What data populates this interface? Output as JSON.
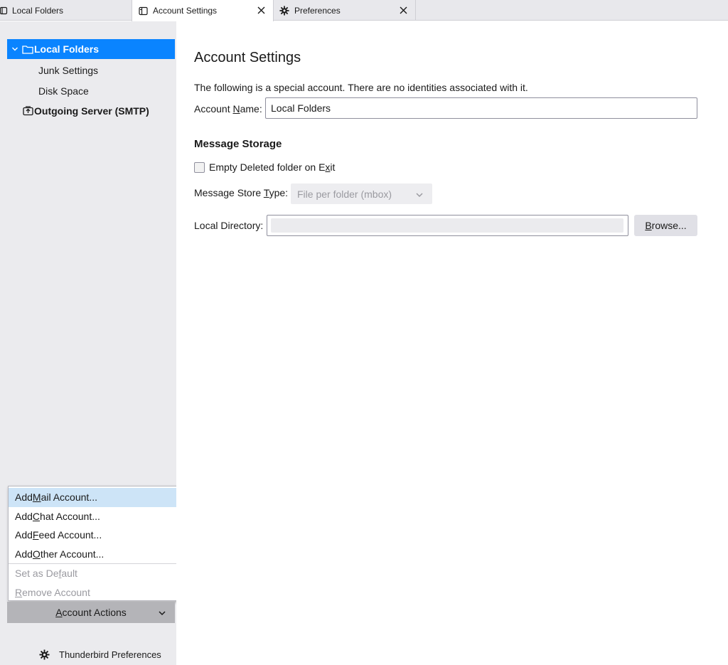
{
  "tabs": [
    {
      "label": "Local Folders",
      "icon": "folder-tab-icon"
    },
    {
      "label": "Account Settings",
      "icon": "settings-page-icon",
      "active": true
    },
    {
      "label": "Preferences",
      "icon": "gear-icon"
    }
  ],
  "sidebar": {
    "tree": [
      {
        "label": "Local Folders",
        "selected": true
      },
      {
        "label": "Junk Settings"
      },
      {
        "label": "Disk Space"
      },
      {
        "label": "Outgoing Server (SMTP)"
      }
    ],
    "menu": {
      "items": [
        {
          "pre": "Add ",
          "key": "M",
          "post": "ail Account..."
        },
        {
          "pre": "Add ",
          "key": "C",
          "post": "hat Account..."
        },
        {
          "pre": "Add ",
          "key": "F",
          "post": "eed Account..."
        },
        {
          "pre": "Add ",
          "key": "O",
          "post": "ther Account..."
        }
      ],
      "disabled_items": [
        {
          "pre": "Set as De",
          "key": "f",
          "post": "ault"
        },
        {
          "pre": "",
          "key": "R",
          "post": "emove Account"
        }
      ]
    },
    "account_actions": {
      "pre": "",
      "key": "A",
      "post": "ccount Actions"
    },
    "thunderbird_prefs": "Thunderbird Preferences"
  },
  "main": {
    "title": "Account Settings",
    "description": "The following is a special account. There are no identities associated with it.",
    "account_name": {
      "pre": "Account ",
      "key": "N",
      "post": "ame:",
      "value": "Local Folders"
    },
    "message_storage": {
      "title": "Message Storage",
      "empty_deleted": {
        "pre": "Empty Deleted folder on E",
        "key": "x",
        "post": "it"
      },
      "store_type": {
        "pre": "Message Store ",
        "key": "T",
        "post": "ype:",
        "value": "File per folder (mbox)"
      },
      "local_directory": {
        "label": "Local Directory:",
        "value": ""
      },
      "browse": {
        "pre": "",
        "key": "B",
        "post": "rowse..."
      }
    }
  },
  "colors": {
    "accent": "#0a84ff",
    "menu_hover": "#cde4f7",
    "sidebar_bg": "#ebebee"
  }
}
